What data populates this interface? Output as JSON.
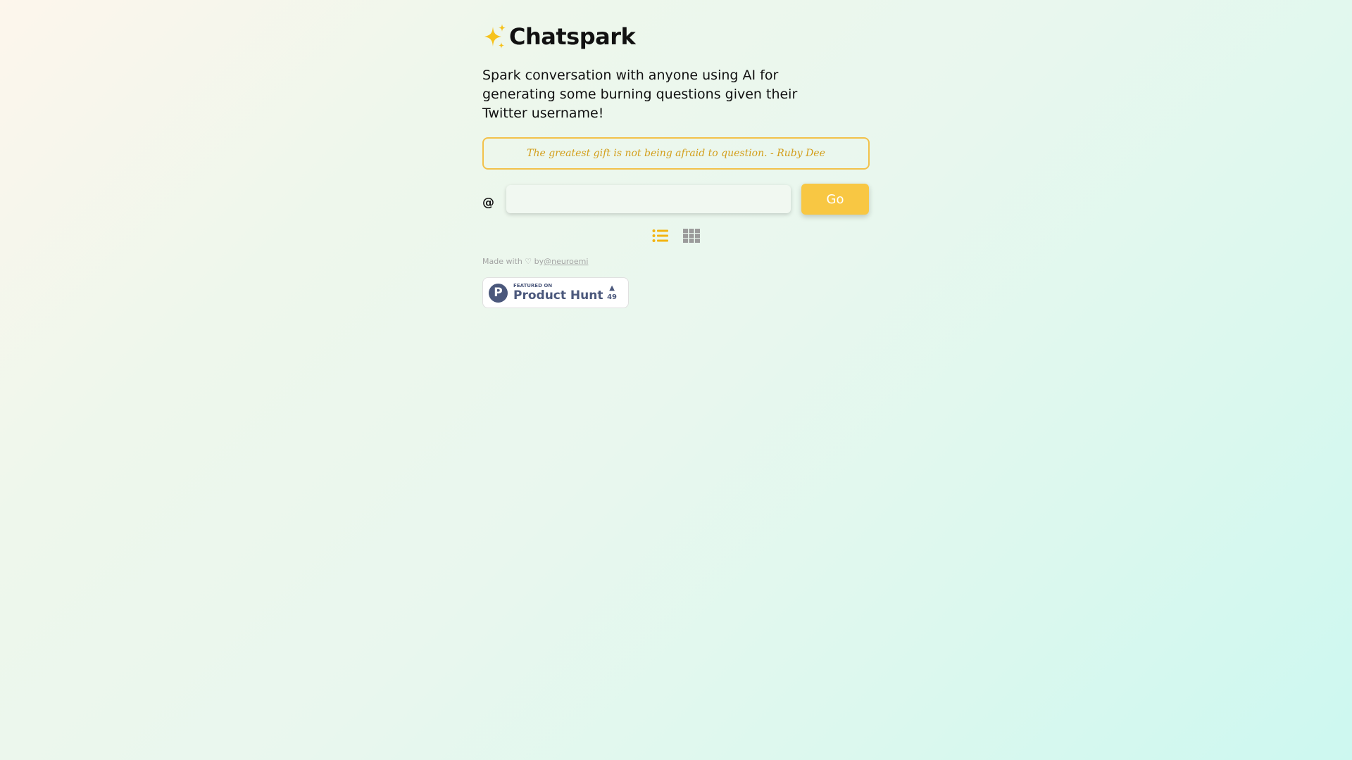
{
  "brand": {
    "title": "Chatspark",
    "logo_icon": "sparkles-icon"
  },
  "tagline": "Spark conversation with anyone using AI for generating some burning questions given their Twitter username!",
  "quote": "The greatest gift is not being afraid to question. - Ruby Dee",
  "search": {
    "prefix": "@",
    "value": "",
    "placeholder": "",
    "go_label": "Go"
  },
  "view_toggles": [
    {
      "icon": "list-view-icon",
      "active": true
    },
    {
      "icon": "grid-view-icon",
      "active": false
    }
  ],
  "credit": {
    "text": "Made with ♡ by",
    "link": "@neuroemi"
  },
  "product_hunt": {
    "featured_label": "FEATURED ON",
    "name": "Product Hunt",
    "logo_letter": "P",
    "arrow": "▲",
    "votes": "49"
  },
  "colors": {
    "accent": "#f8c743",
    "quote_text": "#d39e1a",
    "quote_border": "#f2c14a",
    "inactive_icon": "#9b9b9b",
    "product_hunt": "#4b587c"
  }
}
